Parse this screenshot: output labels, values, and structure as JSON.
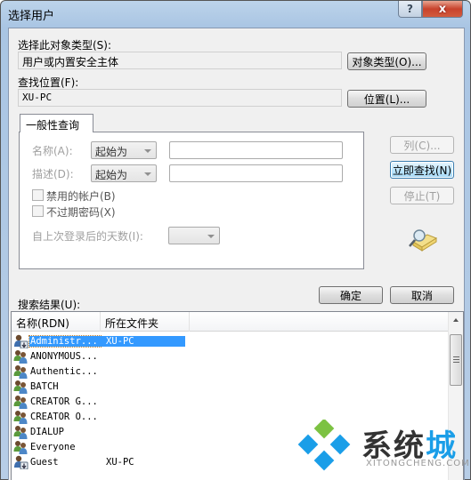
{
  "window": {
    "title": "选择用户",
    "help_label": "?",
    "close_label": "x"
  },
  "object_type": {
    "label": "选择此对象类型(S):",
    "value": "用户或内置安全主体",
    "button": "对象类型(O)..."
  },
  "location": {
    "label": "查找位置(F):",
    "value": "XU-PC",
    "button": "位置(L)..."
  },
  "query": {
    "tab_label": "一般性查询",
    "name_label": "名称(A):",
    "name_combo": "起始为",
    "name_value": "",
    "desc_label": "描述(D):",
    "desc_combo": "起始为",
    "desc_value": "",
    "disabled_accounts": "禁用的帐户(B)",
    "non_expiring_pw": "不过期密码(X)",
    "days_label": "自上次登录后的天数(I):",
    "days_value": ""
  },
  "side_buttons": {
    "columns": "列(C)...",
    "find_now": "立即查找(N)",
    "stop": "停止(T)"
  },
  "ok": "确定",
  "cancel": "取消",
  "results": {
    "label": "搜索结果(U):",
    "columns": [
      "名称(RDN)",
      "所在文件夹"
    ],
    "rows": [
      {
        "name": "Administr...",
        "folder": "XU-PC",
        "icon": "user-icon",
        "selected": true
      },
      {
        "name": "ANONYMOUS...",
        "folder": "",
        "icon": "group-icon"
      },
      {
        "name": "Authentic...",
        "folder": "",
        "icon": "group-icon"
      },
      {
        "name": "BATCH",
        "folder": "",
        "icon": "group-icon"
      },
      {
        "name": "CREATOR G...",
        "folder": "",
        "icon": "group-icon"
      },
      {
        "name": "CREATOR O...",
        "folder": "",
        "icon": "group-icon"
      },
      {
        "name": "DIALUP",
        "folder": "",
        "icon": "group-icon"
      },
      {
        "name": "Everyone",
        "folder": "",
        "icon": "group-icon"
      },
      {
        "name": "Guest",
        "folder": "XU-PC",
        "icon": "user-icon"
      }
    ]
  },
  "watermark": {
    "text_a": "系统",
    "text_b": "城",
    "url": "XITONGCHENG.COM"
  }
}
